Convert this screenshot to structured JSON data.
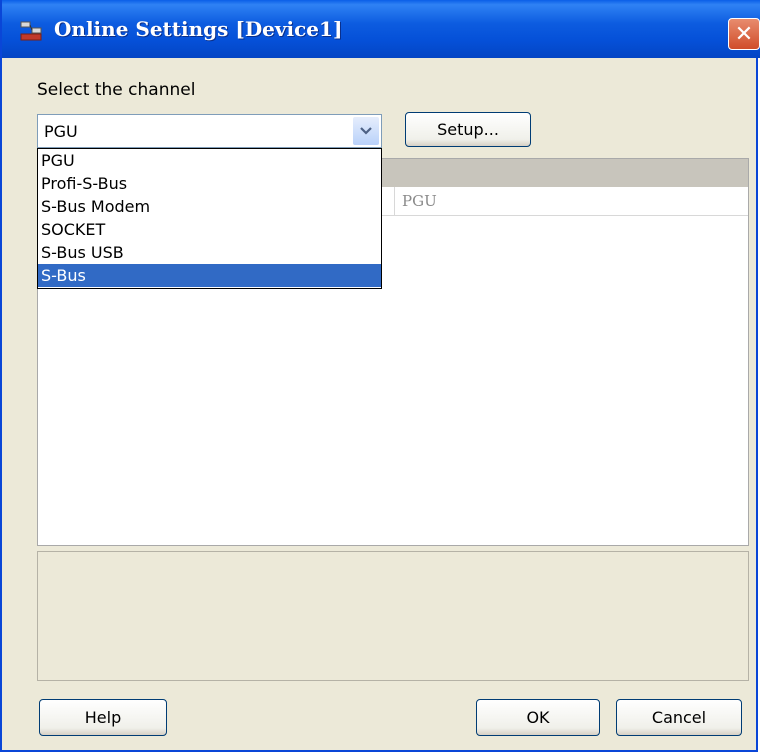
{
  "window": {
    "title": "Online Settings [Device1]",
    "title_icon": "online-settings-icon",
    "close_glyph": "✕"
  },
  "channel": {
    "label": "Select the channel",
    "selected_value": "PGU",
    "options": [
      "PGU",
      "Profi-S-Bus",
      "S-Bus Modem",
      "SOCKET",
      "S-Bus USB",
      "S-Bus"
    ],
    "highlighted_option": "S-Bus"
  },
  "setup_button": "Setup...",
  "properties": {
    "row_value": "PGU"
  },
  "buttons": {
    "help": "Help",
    "ok": "OK",
    "cancel": "Cancel"
  },
  "colors": {
    "titlebar": "#0a5ee8",
    "selection": "#316ac5",
    "window_bg": "#ece9d8"
  }
}
